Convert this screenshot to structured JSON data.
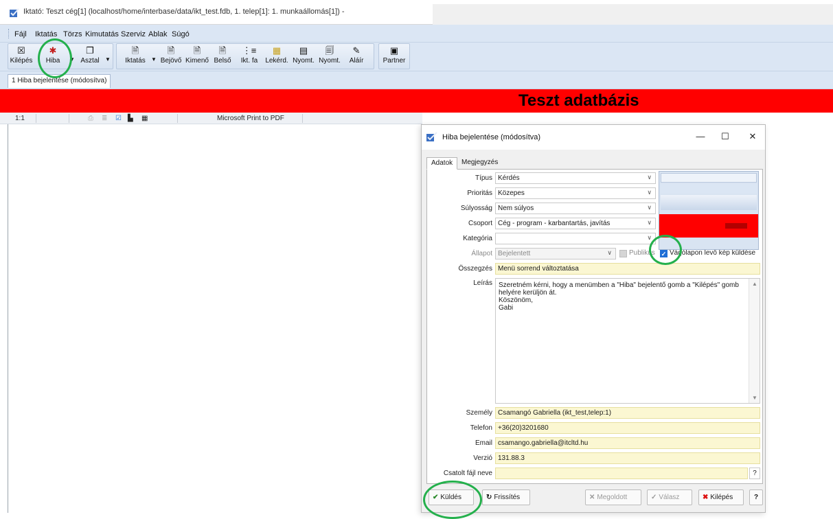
{
  "window": {
    "title": "Iktató: Teszt cég[1] (localhost/home/interbase/data/ikt_test.fdb, 1. telep[1]: 1. munkaállomás[1]) -"
  },
  "menu": [
    "Fájl",
    "Iktatás",
    "Törzs",
    "Kimutatás",
    "Szerviz",
    "Ablak",
    "Súgó"
  ],
  "toolbar": {
    "kilepes": "Kilépés",
    "hiba": "Hiba",
    "asztal": "Asztal",
    "iktatas": "Iktatás",
    "bejovo": "Bejövő",
    "kimeno": "Kimenő",
    "belso": "Belső",
    "iktfa": "Ikt. fa",
    "lekerd": "Lekérd.",
    "nyomt1": "Nyomt.",
    "nyomt2": "Nyomt.",
    "alair": "Aláír",
    "partner": "Partner"
  },
  "tab": {
    "label": "1 Hiba bejelentése (módosítva)"
  },
  "banner": {
    "text": "Teszt adatbázis"
  },
  "statusbar": {
    "position": "1:1",
    "printer": "Microsoft Print to PDF"
  },
  "dialog": {
    "title": "Hiba bejelentése (módosítva)",
    "tabs": [
      "Adatok",
      "Megjegyzés"
    ],
    "labels": {
      "tipus": "Típus",
      "prioritas": "Prioritás",
      "sulyossag": "Súlyosság",
      "csoport": "Csoport",
      "kategoria": "Kategória",
      "allapot": "Állapot",
      "osszegzes": "Összegzés",
      "leiras": "Leírás",
      "szemely": "Személy",
      "telefon": "Telefon",
      "email": "Email",
      "verzio": "Verzió",
      "csatolt": "Csatolt fájl neve"
    },
    "values": {
      "tipus": "Kérdés",
      "prioritas": "Közepes",
      "sulyossag": "Nem súlyos",
      "csoport": "Cég - program - karbantartás, javítás",
      "kategoria": "",
      "allapot": "Bejelentett",
      "osszegzes": "Menü sorrend változtatása",
      "leiras_lines": [
        "Szeretném kérni, hogy a menümben a \"Hiba\" bejelentő gomb a \"Kilépés\" gomb",
        "helyére kerüljön át.",
        "Köszönöm,",
        "Gabi"
      ],
      "szemely": "Csamangó Gabriella (ikt_test,telep:1)",
      "telefon": "+36(20)3201680",
      "email": "csamango.gabriella@itcltd.hu",
      "verzio": "131.88.3",
      "csatolt": ""
    },
    "checkboxes": {
      "publikus": "Publikus",
      "vagolap": "Vágólapon levő kép küldése"
    },
    "buttons": {
      "kuldes": "Küldés",
      "frissites": "Frissítés",
      "megoldott": "Megoldott",
      "valasz": "Válasz",
      "kilepes": "Kilépés",
      "help": "?"
    }
  },
  "colors": {
    "banner": "#ff0000",
    "toolbar_bg": "#dbe6f4",
    "field_yellow": "#fbf7d2",
    "highlight_ring": "#24b04c",
    "checkbox_checked": "#1f6fd6"
  }
}
